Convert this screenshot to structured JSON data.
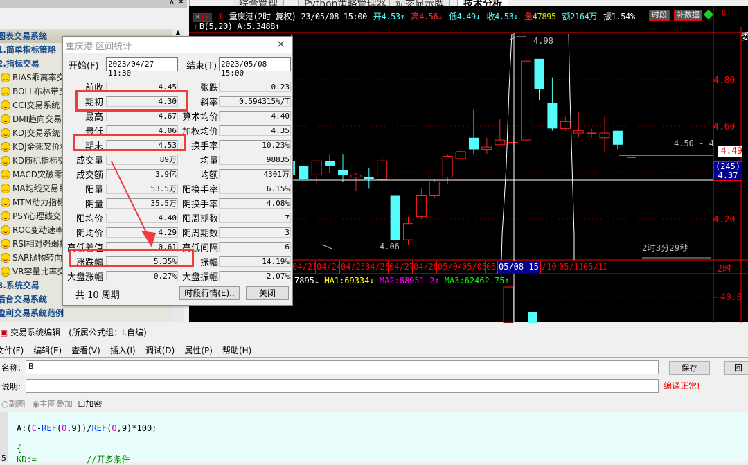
{
  "tabs": [
    "综合管理",
    "Python策略管理器",
    "动态显示牌",
    "技术分析"
  ],
  "sidebar": {
    "pin_icon": "pin-icon",
    "close_icon": "close-icon",
    "items": [
      {
        "label": "图表交易系统",
        "group": true
      },
      {
        "label": "1.简单指标策略",
        "group": true
      },
      {
        "label": "2.指标交易",
        "group": true
      },
      {
        "label": "BIAS乖离率交易系统"
      },
      {
        "label": "BOLL布林带交易系统"
      },
      {
        "label": "CCI交易系统"
      },
      {
        "label": "DMI趋向交易系统"
      },
      {
        "label": "KDJ交易系统"
      },
      {
        "label": "KDJ金死叉价格交易"
      },
      {
        "label": "KD随机指标交易"
      },
      {
        "label": "MACD突破零轴"
      },
      {
        "label": "MA均线交易系统"
      },
      {
        "label": "MTM动力指标交易"
      },
      {
        "label": "PSY心理线交易系统"
      },
      {
        "label": "ROC变动速率交易"
      },
      {
        "label": "RSI相对强弱指标"
      },
      {
        "label": "SAR抛物转向交易"
      },
      {
        "label": "VR容量比率交易"
      },
      {
        "label": "3.系统交易",
        "group": true
      },
      {
        "label": "后台交易系统",
        "group": true
      },
      {
        "label": "盈利交易系统范例",
        "group": true
      }
    ]
  },
  "chart": {
    "period_btn": "K",
    "stock": "重庆港(2时 复权) 23/05/08 15:00",
    "open": "开4.53↑",
    "high": "高4.56↓",
    "low": "低4.49↓",
    "close": "收4.53↓",
    "vol_label": "量",
    "vol": "47895",
    "amount": "额2164万",
    "amp": "振1.54%",
    "btn_period": "时段",
    "btn_fill": "补数据",
    "indicator": "B(5,20) A:5.3488↑",
    "price_ticks": [
      "4.80",
      "4.60",
      "4.20"
    ],
    "cur_price": "4.49",
    "cross_label": "(245)",
    "cross_price": "4.37",
    "high_label": "4.98",
    "low_label": "4.06",
    "range_text": "4.50 - 4",
    "countdown": "2时3分29秒",
    "dates": [
      "04/21",
      "04/24",
      "04/25",
      "04/26",
      "04/27",
      "04/28",
      "05/04",
      "05/05",
      "05/",
      "05/08 15:00",
      "/10",
      "05/11",
      "05/12"
    ],
    "period_label": "2时",
    "vol_line": {
      "v": "7895↓",
      "ma1": "MA1:69334↓",
      "ma2": "MA2:88951.2↑",
      "ma3": "MA3:62462.75↑"
    },
    "vol_tick": "40.0",
    "right_col": "委",
    "colors": {
      "up": "#ff2020",
      "down": "#54fcfc",
      "axis": "#ff0000"
    }
  },
  "chart_data": {
    "type": "candlestick",
    "candles": [
      {
        "o": 4.43,
        "h": 4.43,
        "l": 4.37,
        "c": 4.37
      },
      {
        "o": 4.39,
        "h": 4.45,
        "l": 4.35,
        "c": 4.45
      },
      {
        "o": 4.45,
        "h": 4.48,
        "l": 4.4,
        "c": 4.43
      },
      {
        "o": 4.41,
        "h": 4.48,
        "l": 4.36,
        "c": 4.39
      },
      {
        "o": 4.38,
        "h": 4.4,
        "l": 4.32,
        "c": 4.39
      },
      {
        "o": 4.38,
        "h": 4.42,
        "l": 4.33,
        "c": 4.37
      },
      {
        "o": 4.37,
        "h": 4.47,
        "l": 4.35,
        "c": 4.45
      },
      {
        "o": 4.3,
        "h": 4.3,
        "l": 4.06,
        "c": 4.11
      },
      {
        "o": 4.11,
        "h": 4.21,
        "l": 4.09,
        "c": 4.18
      },
      {
        "o": 4.21,
        "h": 4.33,
        "l": 4.2,
        "c": 4.3
      },
      {
        "o": 4.3,
        "h": 4.37,
        "l": 4.29,
        "c": 4.36
      },
      {
        "o": 4.38,
        "h": 4.48,
        "l": 4.35,
        "c": 4.47
      },
      {
        "o": 4.46,
        "h": 4.5,
        "l": 4.46,
        "c": 4.49
      },
      {
        "o": 4.55,
        "h": 4.67,
        "l": 4.48,
        "c": 4.5
      },
      {
        "o": 4.5,
        "h": 4.55,
        "l": 4.48,
        "c": 4.51
      },
      {
        "o": 4.52,
        "h": 4.63,
        "l": 4.52,
        "c": 4.54
      },
      {
        "o": 4.53,
        "h": 4.56,
        "l": 4.49,
        "c": 4.53
      },
      {
        "o": 4.54,
        "h": 4.98,
        "l": 4.54,
        "c": 4.88
      },
      {
        "o": 4.89,
        "h": 4.89,
        "l": 4.71,
        "c": 4.76
      },
      {
        "o": 4.7,
        "h": 4.81,
        "l": 4.58,
        "c": 4.59
      },
      {
        "o": 4.59,
        "h": 4.64,
        "l": 4.58,
        "c": 4.62
      },
      {
        "o": 4.57,
        "h": 4.66,
        "l": 4.55,
        "c": 4.58
      },
      {
        "o": 4.57,
        "h": 4.59,
        "l": 4.55,
        "c": 4.57
      },
      {
        "o": 4.55,
        "h": 4.64,
        "l": 4.49,
        "c": 4.57
      },
      {
        "o": 4.58,
        "h": 4.58,
        "l": 4.5,
        "c": 4.52
      }
    ]
  },
  "dialog": {
    "title": "重庆港 区间统计",
    "start_label": "开始(F)",
    "start": "2023/04/27 11:30",
    "end_label": "结束(T)",
    "end": "2023/05/08 15:00",
    "left": [
      [
        "前收",
        "4.45"
      ],
      [
        "期初",
        "4.30"
      ],
      [
        "最高",
        "4.67"
      ],
      [
        "最低",
        "4.06"
      ],
      [
        "期末",
        "4.53"
      ],
      [
        "成交量",
        "89万"
      ],
      [
        "成交额",
        "3.9亿"
      ],
      [
        "阳量",
        "53.5万"
      ],
      [
        "阴量",
        "35.5万"
      ],
      [
        "阳均价",
        "4.40"
      ],
      [
        "阴均价",
        "4.29"
      ],
      [
        "高低差值",
        "0.61"
      ],
      [
        "涨跌幅",
        "5.35%"
      ],
      [
        "大盘涨幅",
        "0.27%"
      ]
    ],
    "right": [
      [
        "张跌",
        "0.23"
      ],
      [
        "斜率",
        "0.594315%/T"
      ],
      [
        "算术均价",
        "4.40"
      ],
      [
        "加权均价",
        "4.35"
      ],
      [
        "换手率",
        "10.23%"
      ],
      [
        "均量",
        "98835"
      ],
      [
        "均额",
        "4301万"
      ],
      [
        "阳换手率",
        "6.15%"
      ],
      [
        "阴换手率",
        "4.08%"
      ],
      [
        "阳周期数",
        "7"
      ],
      [
        "阴周期数",
        "3"
      ],
      [
        "高低间隔",
        "6"
      ],
      [
        "振幅",
        "14.19%"
      ],
      [
        "大盘振幅",
        "2.07%"
      ]
    ],
    "periods": "共 10 周期",
    "btn_period": "时段行情(E)..",
    "btn_close": "关闭"
  },
  "editor": {
    "title": "交易系统编辑 - (所属公式组：I.自编)",
    "menu": [
      "文件(F)",
      "编辑(E)",
      "查看(V)",
      "插入(I)",
      "调试(D)",
      "属性(P)",
      "帮助(H)"
    ],
    "name_label": "名称:",
    "name_value": "B",
    "desc_label": "说明:",
    "desc_value": "",
    "save": "保存",
    "back": "回",
    "status": "编译正常!",
    "radio1": "副图",
    "radio2": "主图叠加",
    "check": "加密",
    "code": [
      [
        [
          "A:(",
          "#000"
        ],
        [
          "C",
          "#c000c0"
        ],
        [
          "-",
          "#000"
        ],
        [
          "REF",
          "#0040ff"
        ],
        [
          "(",
          "#000"
        ],
        [
          "O",
          "#c000c0"
        ],
        [
          ",9))/",
          "#000"
        ],
        [
          "REF",
          "#0040ff"
        ],
        [
          "(",
          "#000"
        ],
        [
          "O",
          "#c000c0"
        ],
        [
          ",9)*100;",
          "#000"
        ]
      ],
      [
        [
          "{",
          "#008000"
        ]
      ],
      [
        [
          "KD:=          //开多条件",
          "#008000"
        ]
      ]
    ],
    "line_no": "5"
  }
}
